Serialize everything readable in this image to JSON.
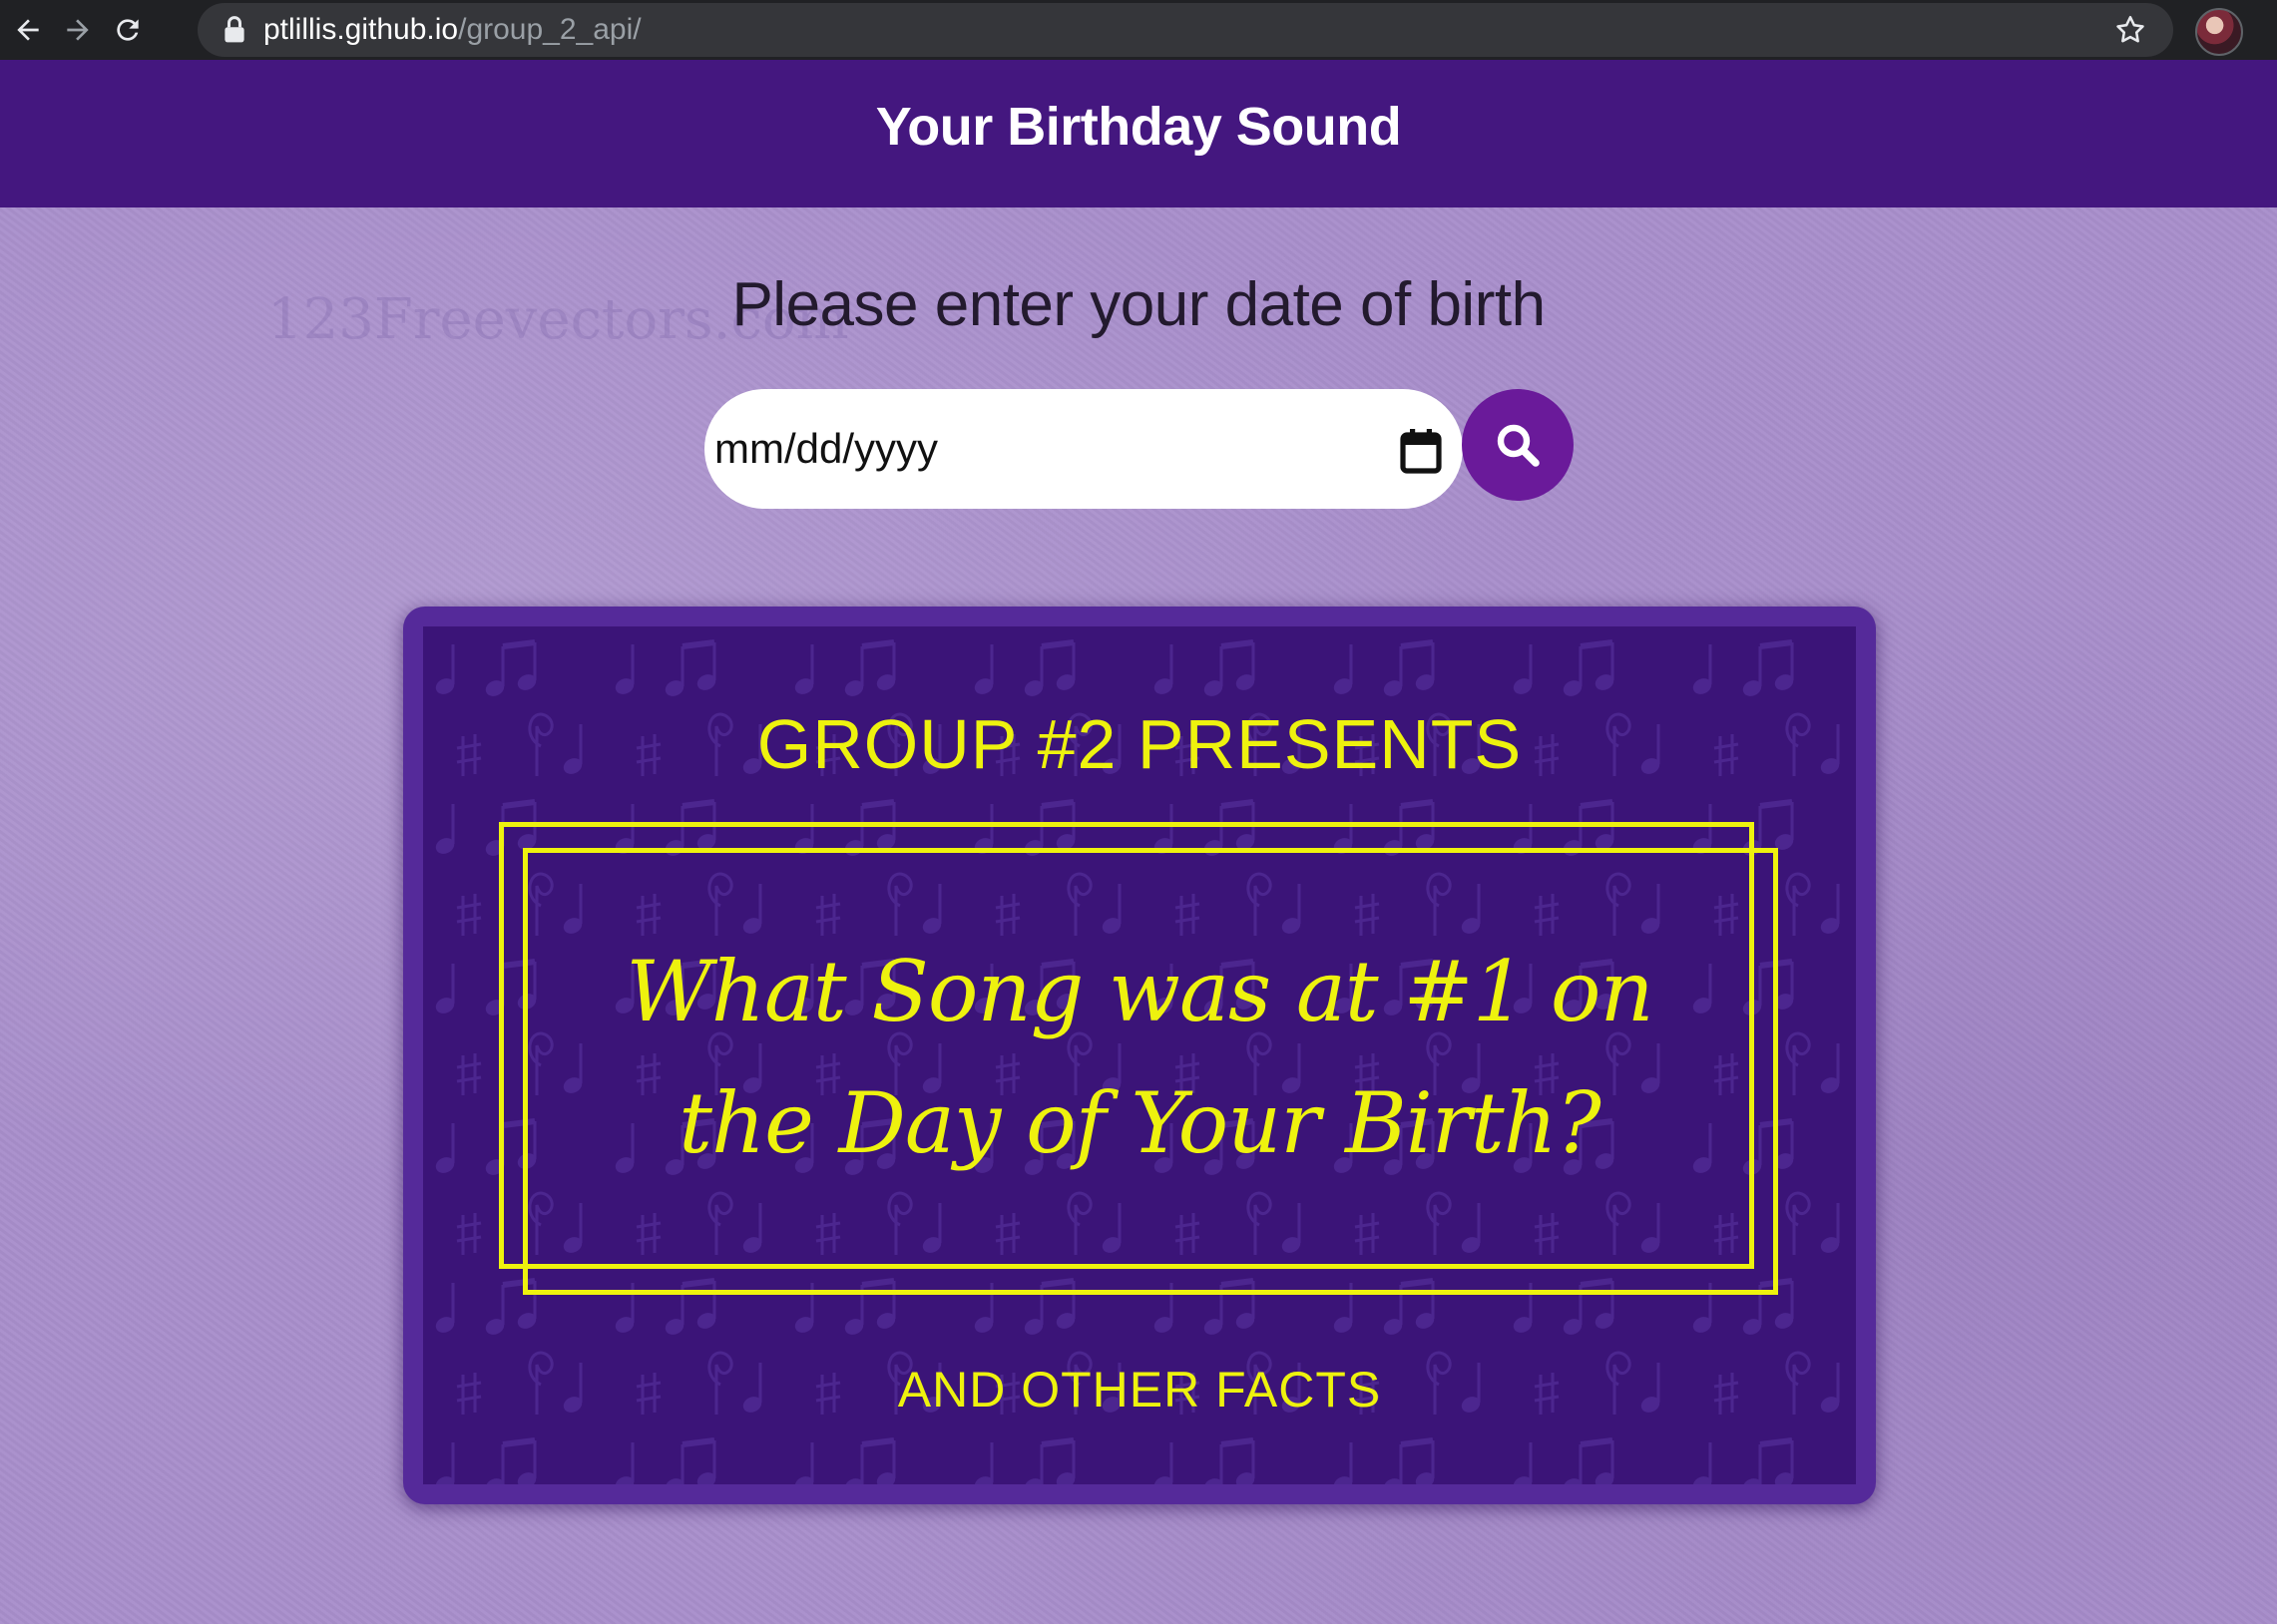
{
  "browser": {
    "url_host": "ptlillis.github.io",
    "url_path": "/group_2_api/",
    "icons": [
      "back-arrow-icon",
      "forward-arrow-icon",
      "reload-icon",
      "lock-icon",
      "bookmark-star-icon"
    ]
  },
  "header": {
    "title": "Your Birthday Sound",
    "color": "#44177f"
  },
  "main": {
    "prompt": "Please enter your date of birth",
    "date_input": {
      "placeholder": "mm/dd/yyyy",
      "icon": "calendar-icon"
    },
    "search_button": {
      "icon": "search-icon",
      "color": "#6a1a9a"
    },
    "banner": {
      "presents": "GROUP #2 PRESENTS",
      "headline_line1": "What Song was at #1 on",
      "headline_line2": "the Day of Your Birth?",
      "footer": "AND OTHER FACTS",
      "text_color": "#eef20e",
      "bg_color": "#3b1478"
    }
  },
  "colors": {
    "page_bg": "#a88ecb"
  }
}
